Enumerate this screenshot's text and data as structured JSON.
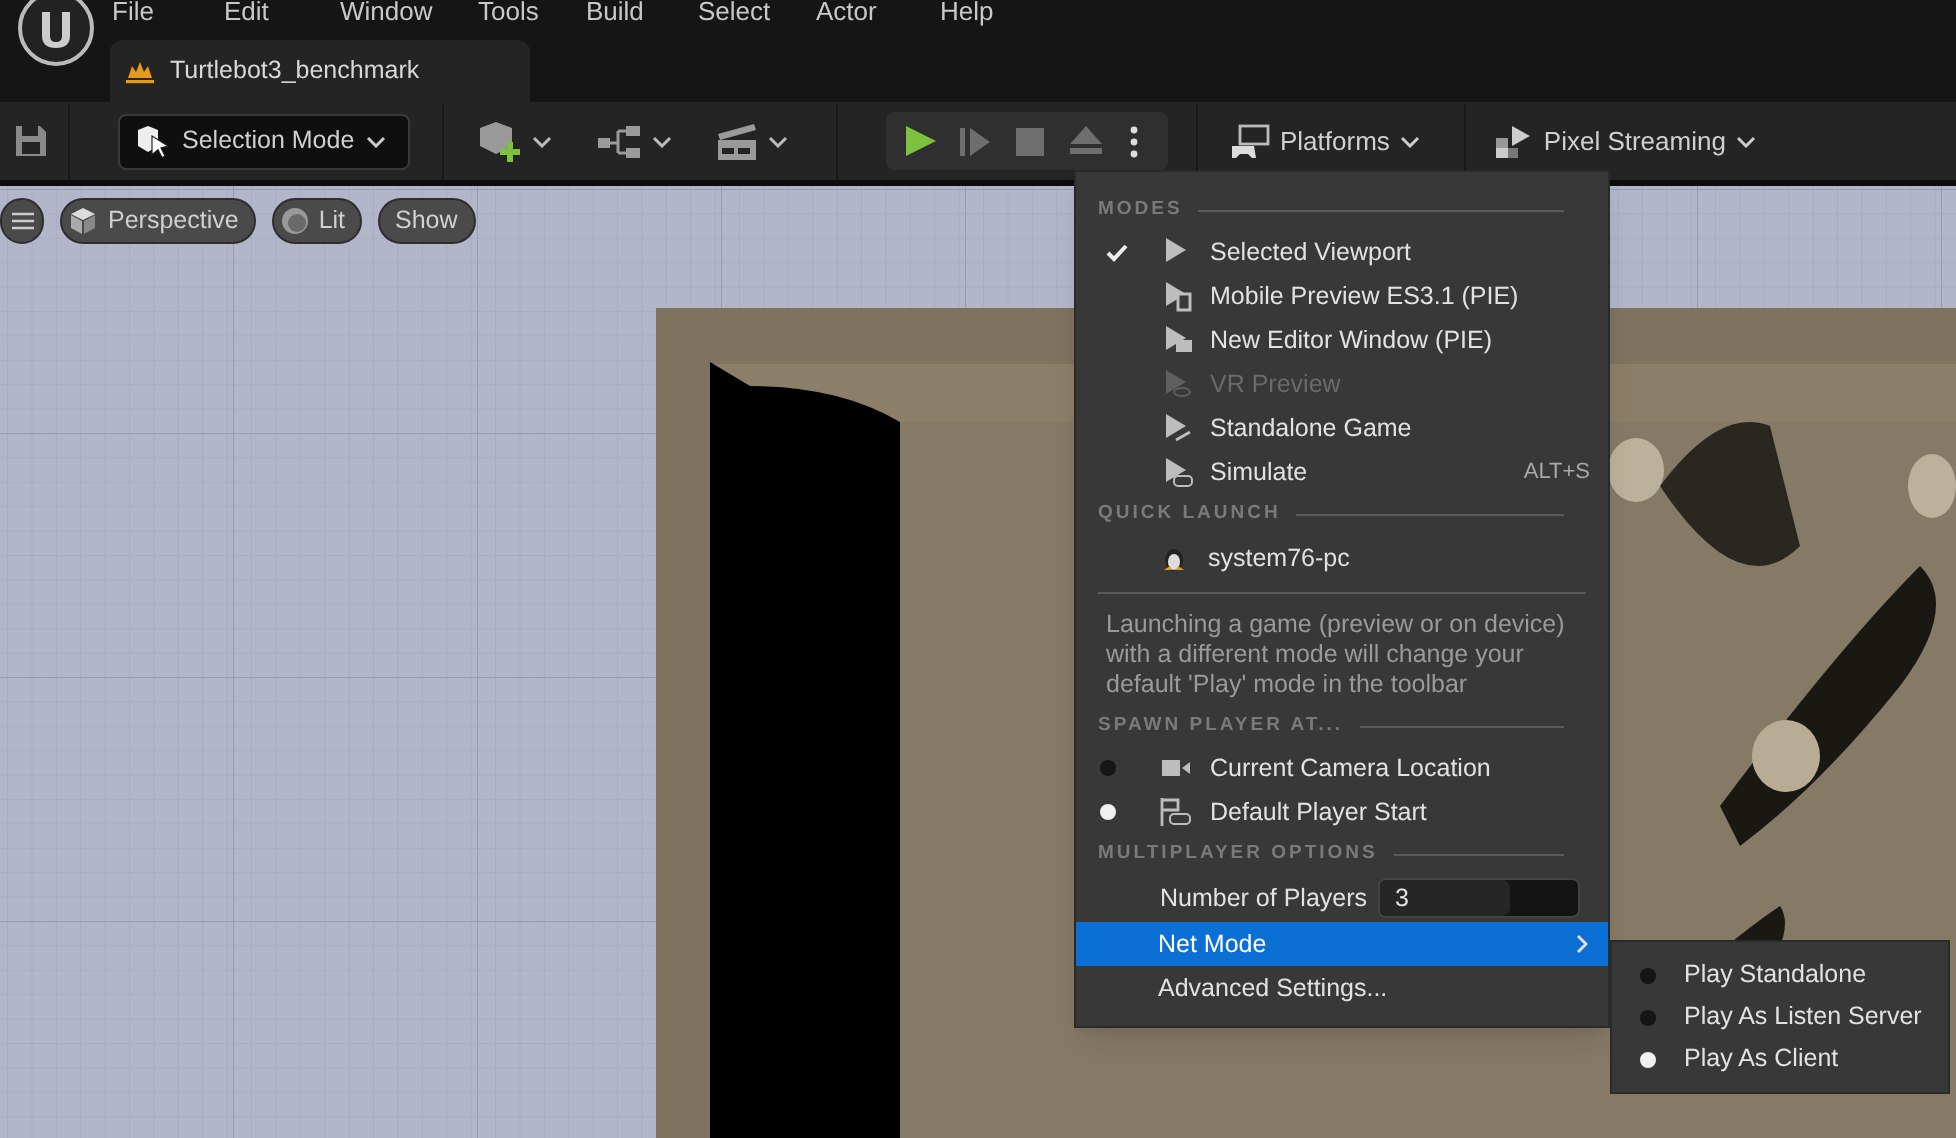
{
  "menu_bar": [
    "File",
    "Edit",
    "Window",
    "Tools",
    "Build",
    "Select",
    "Actor",
    "Help"
  ],
  "document_tab": {
    "title": "Turtlebot3_benchmark"
  },
  "toolbar": {
    "mode_dropdown": "Selection Mode",
    "platforms": "Platforms",
    "pixel_streaming": "Pixel Streaming"
  },
  "viewport": {
    "perspective": "Perspective",
    "lit": "Lit",
    "show": "Show"
  },
  "play_menu": {
    "modes": {
      "title": "MODES",
      "items": [
        {
          "label": "Selected Viewport",
          "checked": true,
          "disabled": false
        },
        {
          "label": "Mobile Preview ES3.1 (PIE)",
          "checked": false,
          "disabled": false
        },
        {
          "label": "New Editor Window (PIE)",
          "checked": false,
          "disabled": false
        },
        {
          "label": "VR Preview",
          "checked": false,
          "disabled": true
        },
        {
          "label": "Standalone Game",
          "checked": false,
          "disabled": false
        },
        {
          "label": "Simulate",
          "checked": false,
          "disabled": false,
          "shortcut": "ALT+S"
        }
      ]
    },
    "quick_launch": {
      "title": "QUICK LAUNCH",
      "items": [
        "system76-pc"
      ]
    },
    "note": "Launching a game (preview or on device) with a different mode will change your default 'Play' mode in the toolbar",
    "spawn": {
      "title": "SPAWN PLAYER AT...",
      "items": [
        {
          "label": "Current Camera Location",
          "selected": false
        },
        {
          "label": "Default Player Start",
          "selected": true
        }
      ]
    },
    "multiplayer": {
      "title": "MULTIPLAYER OPTIONS",
      "number_of_players": {
        "label": "Number of Players",
        "value": "3",
        "level": 0.66
      },
      "net_mode": {
        "label": "Net Mode",
        "selected": true
      },
      "advanced": "Advanced Settings..."
    }
  },
  "net_mode_menu": [
    {
      "label": "Play Standalone",
      "selected": false
    },
    {
      "label": "Play As Listen Server",
      "selected": false
    },
    {
      "label": "Play As Client",
      "selected": true
    }
  ]
}
